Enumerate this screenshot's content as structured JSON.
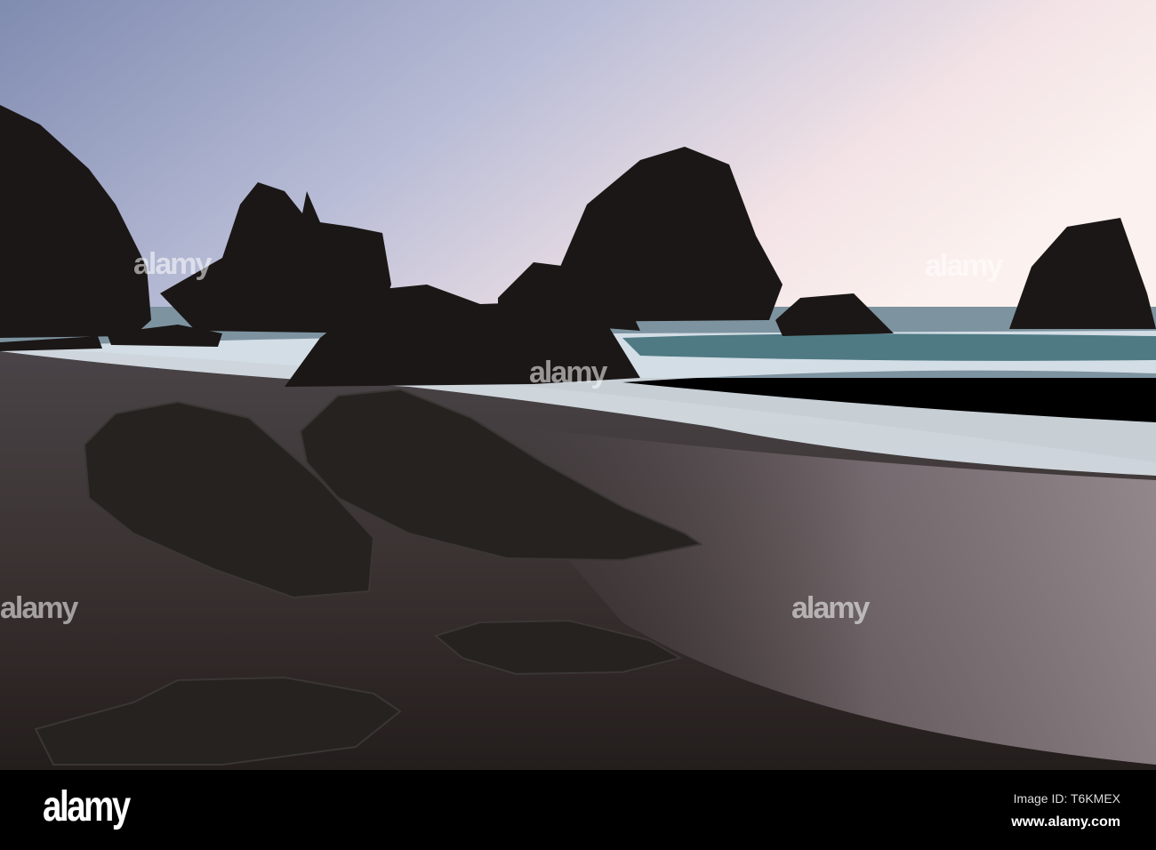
{
  "photo": {
    "subject": "Sea stacks and rocks on a dark sand beach at dusk with waves"
  },
  "watermark": {
    "text": "alamy"
  },
  "footer": {
    "logo": "alamy",
    "image_id": "Image ID: T6KMEX",
    "website": "www.alamy.com"
  },
  "colors": {
    "sky_top": "#8e9bbd",
    "sky_glow": "#f6e6e6",
    "rock": "#1a1715",
    "sand": "#3a3230",
    "foam": "#e8eef3",
    "footer": "#000000"
  }
}
